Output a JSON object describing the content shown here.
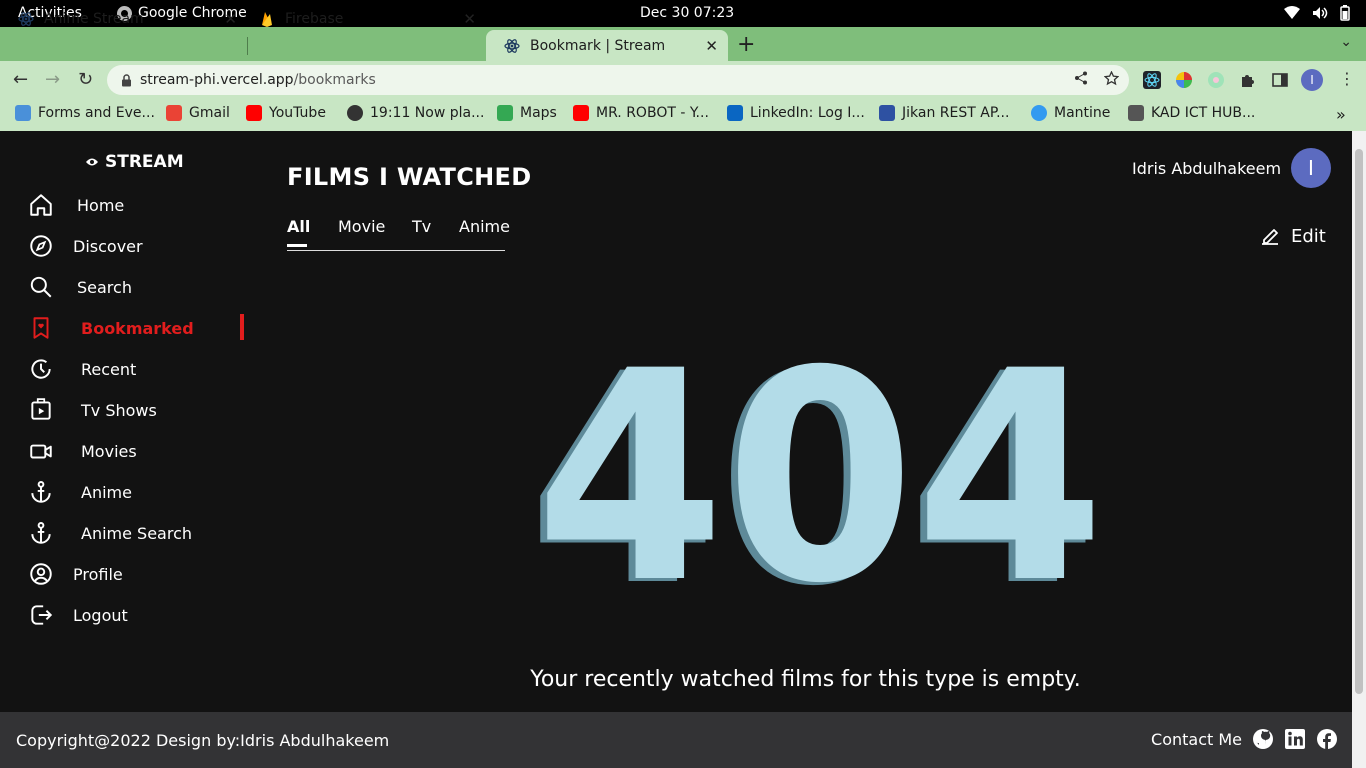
{
  "system_bar": {
    "activities": "Activities",
    "app_name": "Google Chrome",
    "clock": "Dec 30  07:23"
  },
  "browser": {
    "tabs": [
      {
        "title": "Anime Stream",
        "icon": "react-icon"
      },
      {
        "title": "Firebase",
        "icon": "firebase-icon"
      },
      {
        "title": "Bookmark | Stream",
        "icon": "react-icon"
      }
    ],
    "url_host": "stream-phi.vercel.app",
    "url_path": "/bookmarks",
    "profile_initial": "I",
    "bookmarks": [
      {
        "label": "Forms and Eve...",
        "icon": "forms-icon",
        "color": "#4a90d9"
      },
      {
        "label": "Gmail",
        "icon": "gmail-icon",
        "color": "#ea4335"
      },
      {
        "label": "YouTube",
        "icon": "youtube-icon",
        "color": "#ff0000"
      },
      {
        "label": "19:11 Now pla...",
        "icon": "globe-icon",
        "color": "#333333"
      },
      {
        "label": "Maps",
        "icon": "maps-icon",
        "color": "#34a853"
      },
      {
        "label": "MR. ROBOT - Y...",
        "icon": "youtube-icon",
        "color": "#ff0000"
      },
      {
        "label": "LinkedIn: Log I...",
        "icon": "linkedin-icon",
        "color": "#0a66c2"
      },
      {
        "label": "Jikan REST AP...",
        "icon": "jikan-icon",
        "color": "#2e51a2"
      },
      {
        "label": "Mantine",
        "icon": "mantine-icon",
        "color": "#339af0"
      },
      {
        "label": "KAD ICT HUB...",
        "icon": "kad-icon",
        "color": "#555555"
      }
    ]
  },
  "sidebar": {
    "brand": "STREAM",
    "items": [
      {
        "label": "Home",
        "icon": "home-icon"
      },
      {
        "label": "Discover",
        "icon": "compass-icon"
      },
      {
        "label": "Search",
        "icon": "search-icon"
      },
      {
        "label": "Bookmarked",
        "icon": "bookmark-heart-icon"
      },
      {
        "label": "Recent",
        "icon": "clock-icon"
      },
      {
        "label": "Tv Shows",
        "icon": "tv-icon"
      },
      {
        "label": "Movies",
        "icon": "video-icon"
      },
      {
        "label": "Anime",
        "icon": "anchor-icon"
      },
      {
        "label": "Anime Search",
        "icon": "anchor-icon"
      },
      {
        "label": "Profile",
        "icon": "user-circle-icon"
      },
      {
        "label": "Logout",
        "icon": "logout-icon"
      }
    ],
    "active_color": "#e11d1d"
  },
  "main": {
    "title": "FILMS I WATCHED",
    "filter_tabs": [
      "All",
      "Movie",
      "Tv",
      "Anime"
    ],
    "user_name": "Idris Abdulhakeem",
    "user_initial": "I",
    "edit_label": "Edit",
    "error_code": "404",
    "empty_message": "Your recently watched films for this type is empty."
  },
  "footer": {
    "copyright": "Copyright@2022 Design by:Idris Abdulhakeem",
    "contact": "Contact Me"
  },
  "colors": {
    "accent": "#e11d1d",
    "avatar": "#5c6bc0",
    "illustration": "#b3dce8",
    "page_bg": "#121212",
    "footer_bg": "#333335"
  }
}
